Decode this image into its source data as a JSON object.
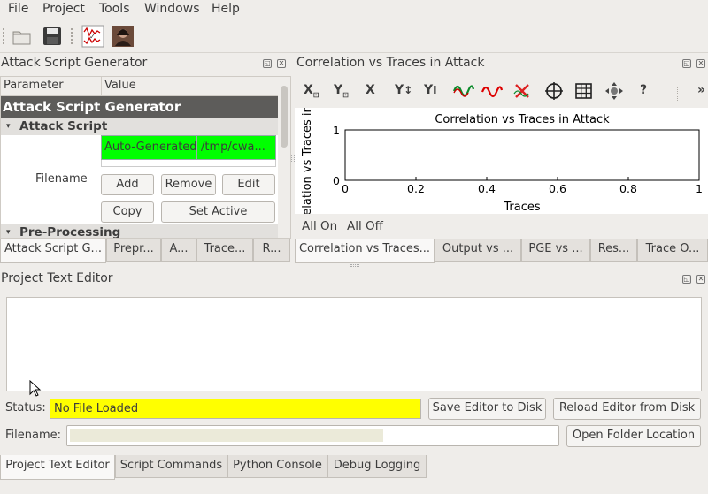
{
  "menu": [
    "File",
    "Project",
    "Tools",
    "Windows",
    "Help"
  ],
  "toolbar": {
    "icons": [
      "folder-open-icon",
      "save-icon",
      "waveform-icon",
      "photo-icon"
    ]
  },
  "left_dock": {
    "title": "Attack Script Generator",
    "tree_header": {
      "parameter": "Parameter",
      "value": "Value"
    },
    "top_row": "Attack Script Generator",
    "group_attack_script": "Attack Script",
    "filename_label": "Filename",
    "filename_cells": [
      "Auto-Generated",
      "/tmp/cwa..."
    ],
    "buttons": {
      "add": "Add",
      "remove": "Remove",
      "edit": "Edit",
      "copy": "Copy",
      "set_active": "Set Active"
    },
    "group_preprocessing": "Pre-Processing",
    "tabs": [
      "Attack Script G...",
      "Prepr...",
      "A...",
      "Trace...",
      "R..."
    ]
  },
  "right_dock": {
    "title": "Correlation vs Traces in Attack",
    "toolbar_labels": [
      "X",
      "Y",
      "X",
      "Y",
      "Y",
      "?",
      "»"
    ],
    "toolbar_icons": [
      "x-autoscale-icon",
      "y-autoscale-icon",
      "x-lock-icon",
      "y-lock-icon",
      "y-log-icon",
      "green-wave-icon",
      "red-wave-icon",
      "red-cross-icon",
      "crosshair-icon",
      "grid-icon",
      "move-icon",
      "help-icon",
      "overflow-icon"
    ],
    "chart_links": {
      "all_on": "All On",
      "all_off": "All Off"
    },
    "tabs": [
      "Correlation vs Traces...",
      "Output vs ...",
      "PGE vs ...",
      "Res...",
      "Trace O..."
    ]
  },
  "chart_data": {
    "type": "line",
    "title": "Correlation vs Traces in Attack",
    "xlabel": "Traces",
    "ylabel": "elation vs Traces in",
    "xlim": [
      0,
      1
    ],
    "ylim": [
      0,
      1
    ],
    "x_ticks": [
      "0",
      "0.2",
      "0.4",
      "0.6",
      "0.8",
      "1"
    ],
    "y_ticks": [
      "1",
      "0"
    ],
    "series": []
  },
  "editor": {
    "title": "Project Text Editor",
    "status_label": "Status:",
    "status_value": "No File Loaded",
    "status_color": "#ffff00",
    "save_button": "Save Editor to Disk",
    "reload_button": "Reload Editor from Disk",
    "filename_label": "Filename:",
    "open_folder_button": "Open Folder Location"
  },
  "bottom_tabs": [
    "Project Text Editor",
    "Script Commands",
    "Python Console",
    "Debug Logging"
  ],
  "colors": {
    "green_cell": "#00ff00",
    "group_header": "#5d5c5a",
    "yellow_status": "#ffff00"
  }
}
